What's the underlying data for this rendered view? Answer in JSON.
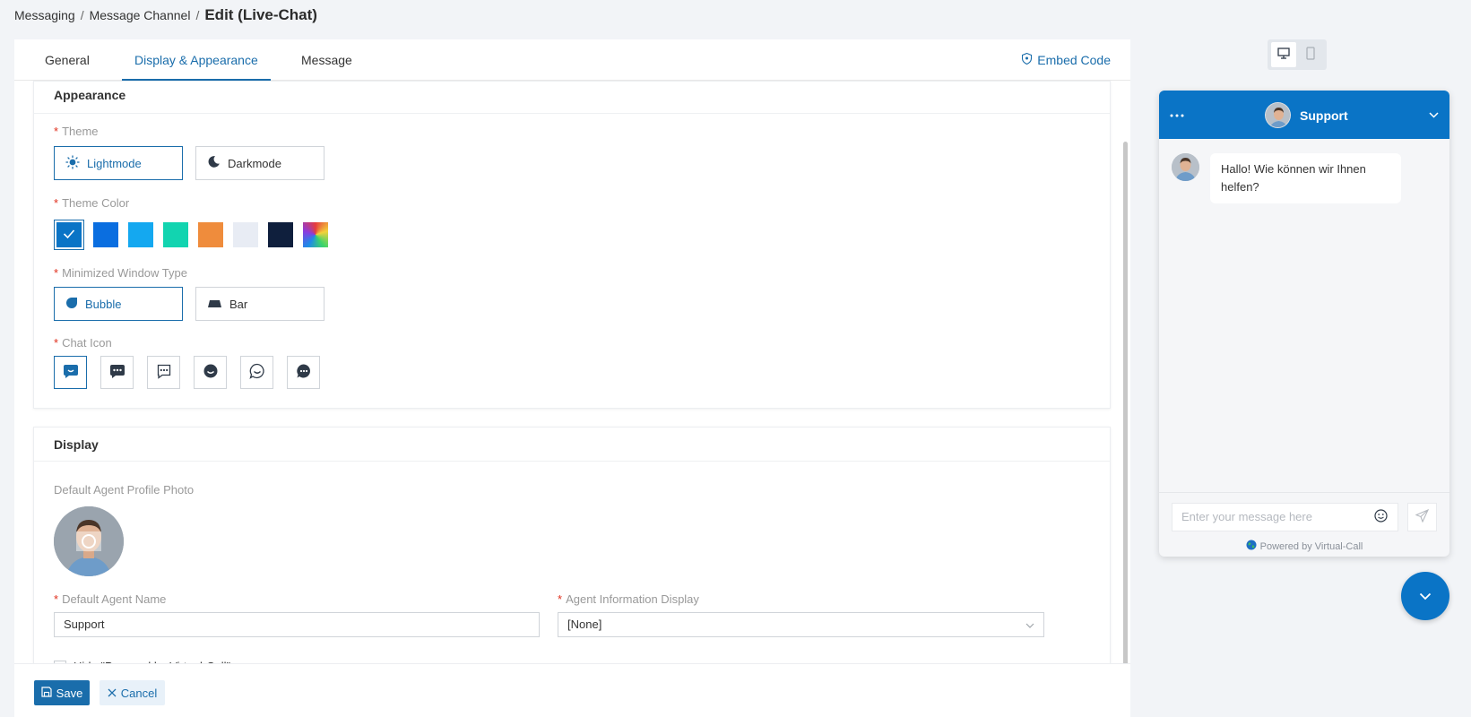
{
  "breadcrumb": {
    "items": [
      "Messaging",
      "Message Channel"
    ],
    "separator": "/",
    "current": "Edit (Live-Chat)"
  },
  "tabs": [
    {
      "label": "General",
      "active": false
    },
    {
      "label": "Display & Appearance",
      "active": true
    },
    {
      "label": "Message",
      "active": false
    }
  ],
  "embed_code": {
    "label": "Embed Code",
    "icon": "shield-icon"
  },
  "appearance": {
    "title": "Appearance",
    "theme": {
      "label": "Theme",
      "options": [
        {
          "label": "Lightmode",
          "icon": "sun-icon",
          "selected": true
        },
        {
          "label": "Darkmode",
          "icon": "moon-icon",
          "selected": false
        }
      ]
    },
    "theme_color": {
      "label": "Theme Color",
      "colors": [
        "#0a74c6",
        "#0a6ee0",
        "#14a8f0",
        "#12d4b0",
        "#ef8c3c",
        "#e8ecf4",
        "#0f1f3d",
        "gradient"
      ],
      "selected_index": 0
    },
    "minimized_window_type": {
      "label": "Minimized Window Type",
      "options": [
        {
          "label": "Bubble",
          "icon": "bubble-icon",
          "selected": true
        },
        {
          "label": "Bar",
          "icon": "bar-icon",
          "selected": false
        }
      ]
    },
    "chat_icon": {
      "label": "Chat Icon",
      "icons": [
        "chat-smile-icon",
        "chat-dots-filled-icon",
        "chat-dots-outline-icon",
        "chat-round-smile-icon",
        "chat-round-outline-icon",
        "chat-round-dots-icon"
      ],
      "selected_index": 0
    }
  },
  "display": {
    "title": "Display",
    "profile_photo_label": "Default Agent Profile Photo",
    "agent_name": {
      "label": "Default Agent Name",
      "value": "Support"
    },
    "agent_info_display": {
      "label": "Agent Information Display",
      "value": "[None]"
    },
    "hide_powered": {
      "label": "Hide \"Powered by Virtual-Call\"",
      "checked": false
    }
  },
  "footer": {
    "save_label": "Save",
    "cancel_label": "Cancel"
  },
  "preview": {
    "active_device": "desktop",
    "header_title": "Support",
    "message": "Hallo! Wie können wir Ihnen helfen?",
    "input_placeholder": "Enter your message here",
    "powered_by": "Powered by Virtual-Call",
    "accent_color": "#0a74c6"
  }
}
